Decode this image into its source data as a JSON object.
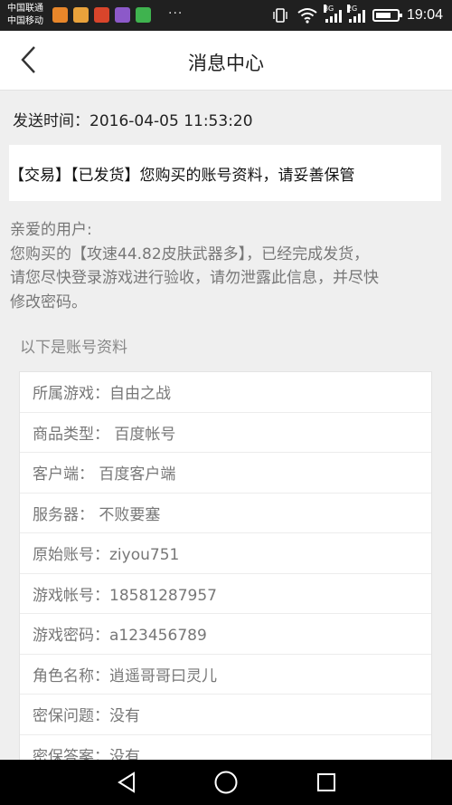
{
  "status_bar": {
    "carrier_1": "中国联通",
    "carrier_2": "中国移动",
    "overflow": "···",
    "net_1": "3G",
    "net_2": "2G",
    "time": "19:04"
  },
  "title_bar": {
    "title": "消息中心"
  },
  "message": {
    "send_time": "发送时间：2016-04-05 11:53:20",
    "headline": "【交易】【已发货】您购买的账号资料，请妥善保管",
    "greeting": "亲爱的用户:",
    "body_line_1": "您购买的【攻速44.82皮肤武器多】，已经完成发货，",
    "body_line_2": "请您尽快登录游戏进行验收，请勿泄露此信息，并尽快",
    "body_line_3": "修改密码。",
    "account_header": "以下是账号资料",
    "rows": [
      "所属游戏：自由之战",
      "商品类型： 百度帐号",
      "客户端： 百度客户端",
      "服务器： 不败要塞",
      "原始账号：ziyou751",
      "游戏帐号：18581287957",
      "游戏密码：a123456789",
      "角色名称：逍遥哥哥曰灵儿",
      "密保问题：没有",
      "密保答案：没有"
    ]
  },
  "colors": {
    "status_bar": "#202020",
    "page_bg": "#efefef",
    "card_bg": "#ffffff",
    "text_primary": "#222222",
    "text_secondary": "#777777"
  }
}
